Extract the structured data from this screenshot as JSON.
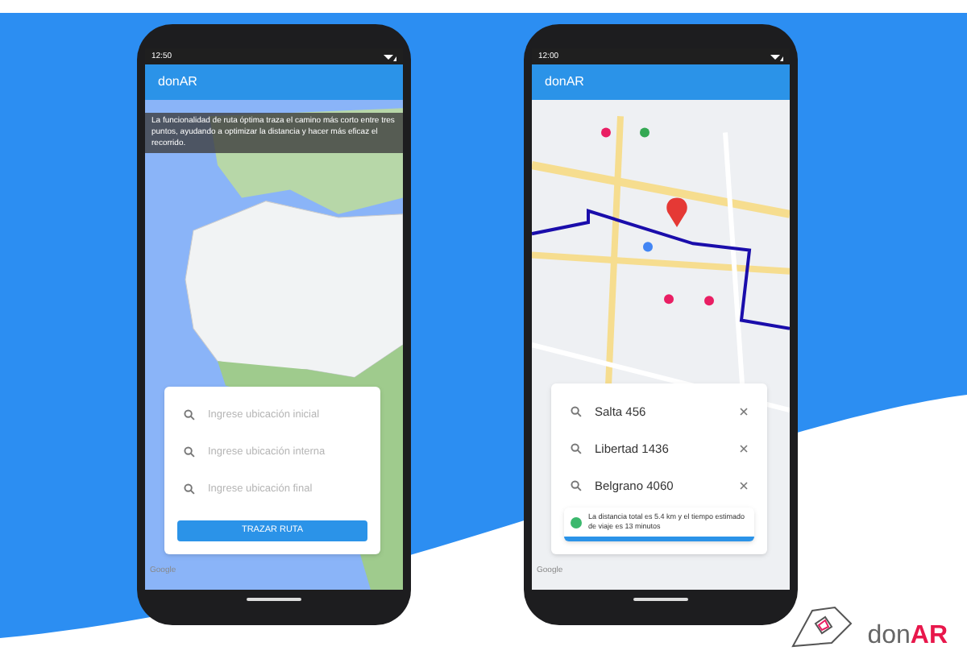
{
  "phones": [
    {
      "kind": "search",
      "status_time": "12:50",
      "app_title": "donAR",
      "tooltip": "La funcionalidad de ruta óptima traza el camino más corto entre tres puntos, ayudando a optimizar la distancia y hacer más eficaz el recorrido.",
      "fields": [
        {
          "placeholder": "Ingrese ubicación inicial"
        },
        {
          "placeholder": "Ingrese ubicación interna"
        },
        {
          "placeholder": "Ingrese ubicación final"
        }
      ],
      "button": "TRAZAR RUTA",
      "attribution": "Google"
    },
    {
      "kind": "route",
      "status_time": "12:00",
      "app_title": "donAR",
      "fields": [
        {
          "value": "Salta 456"
        },
        {
          "value": "Libertad 1436"
        },
        {
          "value": "Belgrano 4060"
        }
      ],
      "info": "La distancia total es 5.4 km y el tiempo estimado de viaje es 13 minutos",
      "attribution": "Google"
    }
  ],
  "logo": {
    "prefix": "don",
    "accent": "AR"
  }
}
